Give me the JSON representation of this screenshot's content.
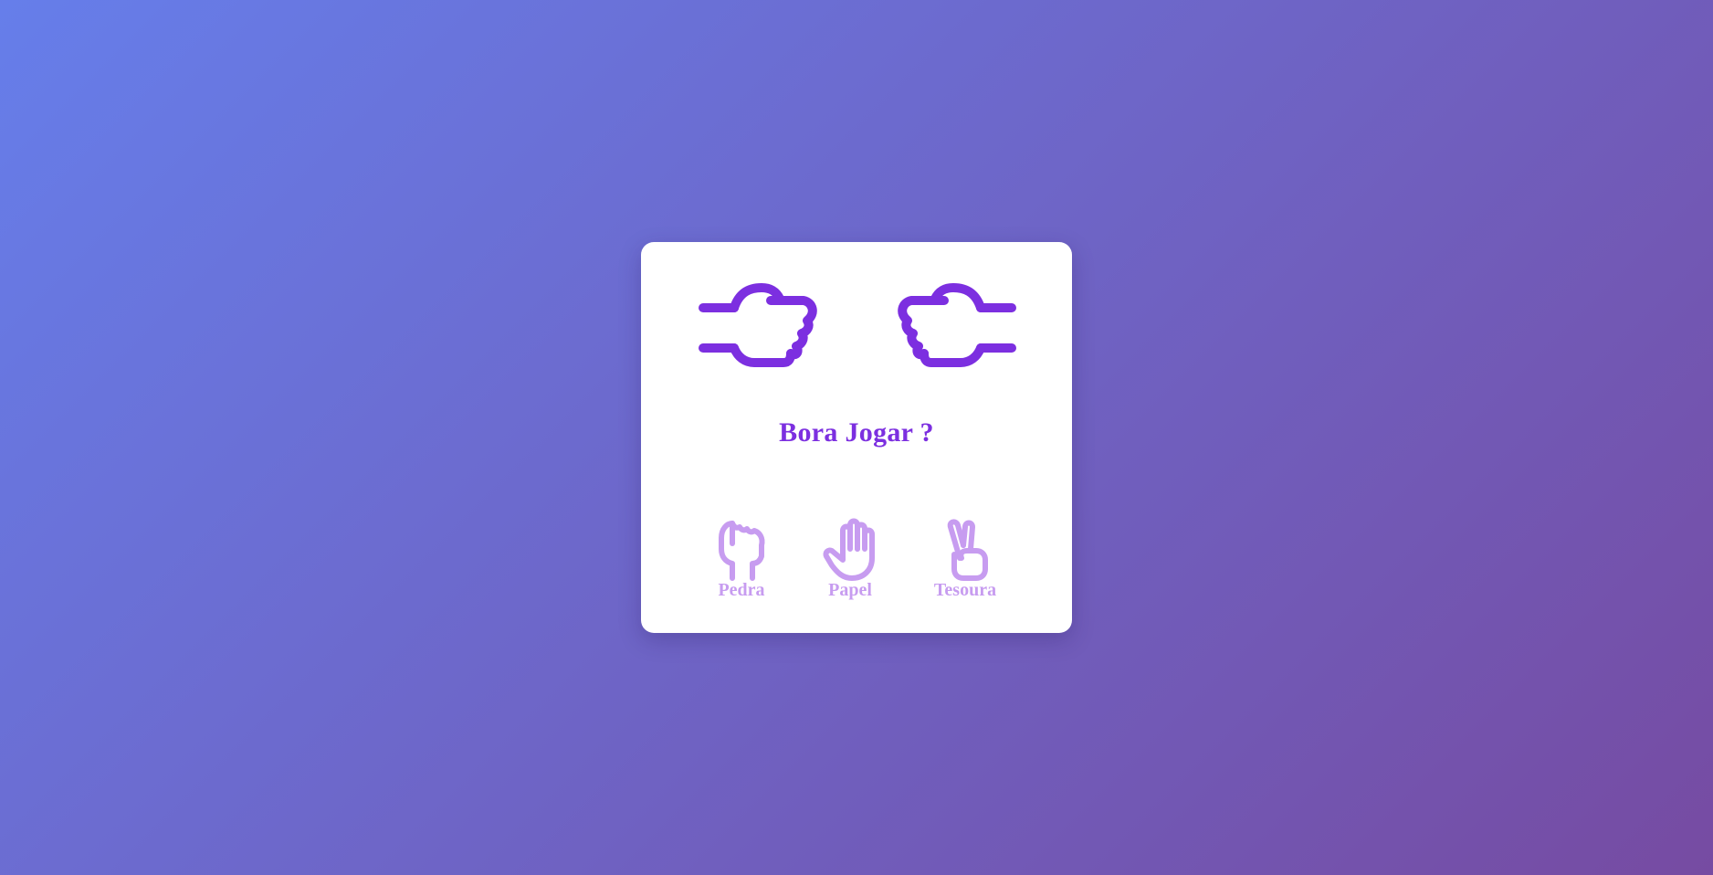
{
  "game": {
    "title": "Bora Jogar ?",
    "player_hand_icon": "fist-pointing-right-icon",
    "computer_hand_icon": "fist-pointing-left-icon"
  },
  "choices": [
    {
      "label": "Pedra",
      "icon": "rock-hand-icon"
    },
    {
      "label": "Papel",
      "icon": "paper-hand-icon"
    },
    {
      "label": "Tesoura",
      "icon": "scissors-hand-icon"
    }
  ],
  "colors": {
    "accent": "#7c2fe0",
    "choice": "#c79cf0",
    "background_start": "#667eea",
    "background_end": "#764ba2",
    "card": "#ffffff"
  }
}
